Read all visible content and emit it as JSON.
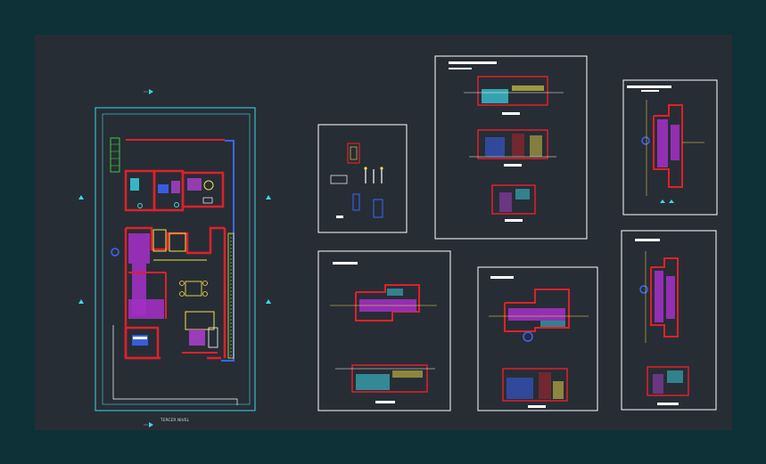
{
  "app": {
    "title": "",
    "background": "#0e3137",
    "model_space": "#272d35"
  },
  "drawing": {
    "main_plan_label": "TERCER NIVEL",
    "sheet_labels": {
      "elevations_sheet_title": "",
      "plan_sheet_a_title": "",
      "plan_sheet_b_title": "",
      "right_upper_sheet_title": "",
      "right_lower_sheet_title": ""
    },
    "colors": {
      "frame": "#ffffff",
      "wall_red": "#e0202a",
      "wall_dark_red": "#a0101a",
      "hatch_magenta": "#b040d0",
      "cyan": "#3fd6e6",
      "yellow": "#f3e04a",
      "green": "#40c840",
      "blue": "#3a66ff",
      "gray": "#9aa4ab"
    }
  }
}
